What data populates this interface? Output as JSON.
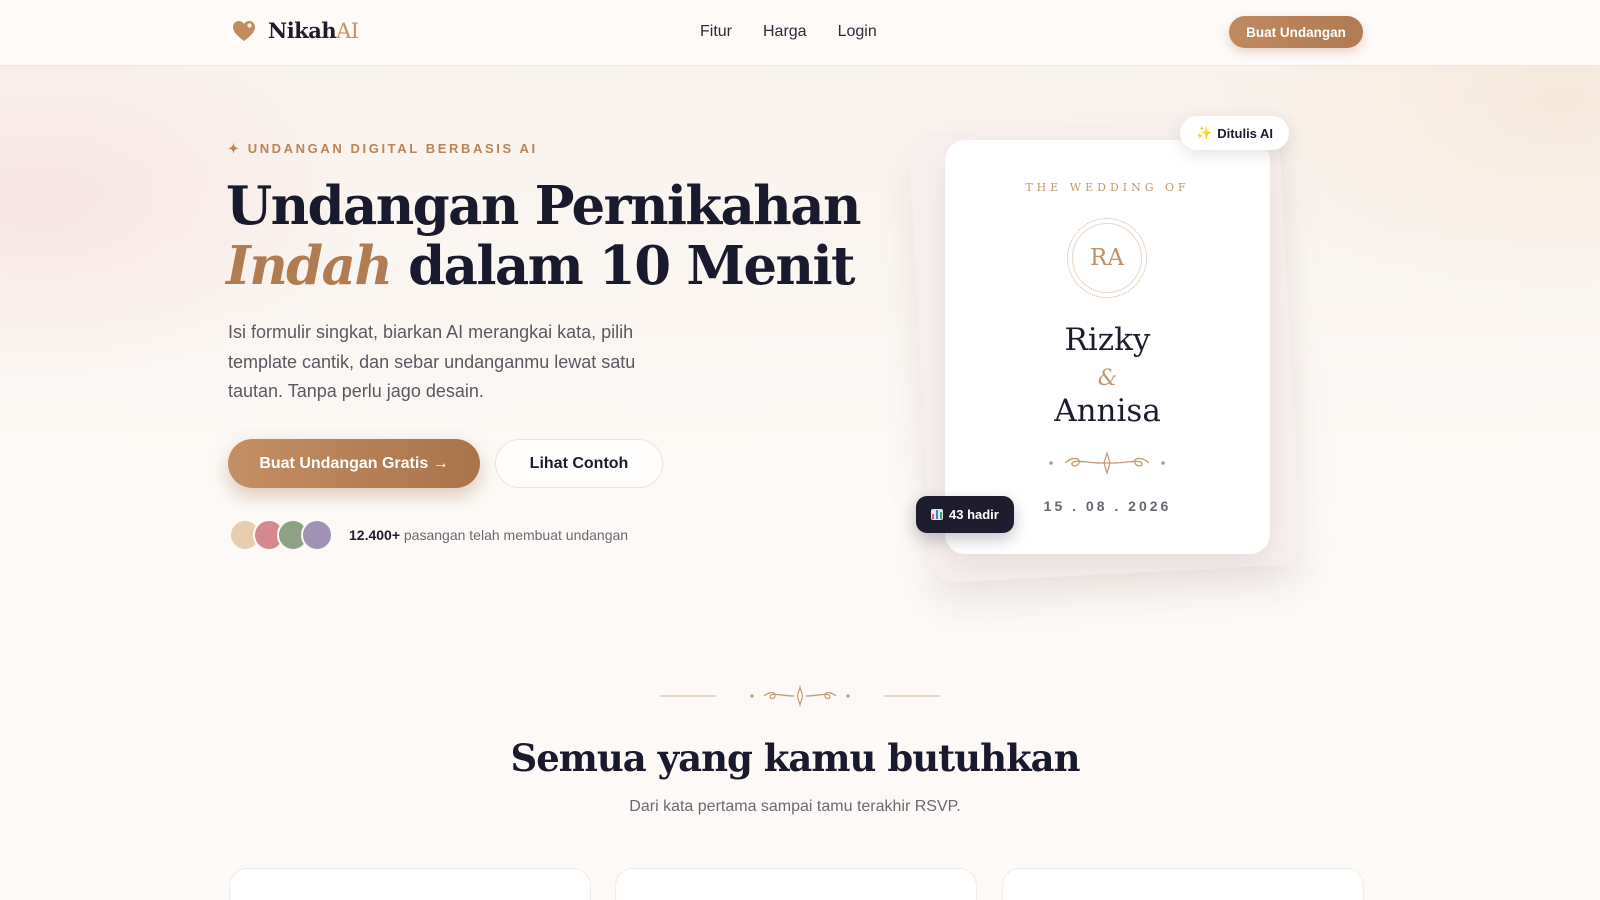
{
  "brand": {
    "name_main": "Nikah",
    "name_accent": "AI"
  },
  "nav": {
    "links": [
      "Fitur",
      "Harga",
      "Login"
    ],
    "cta_label": "Buat Undangan"
  },
  "hero": {
    "eyebrow": "✦ UNDANGAN DIGITAL BERBASIS AI",
    "title_line1": "Undangan Pernikahan",
    "title_accent": "Indah",
    "title_line2_rest": " dalam 10 Menit",
    "subtitle": "Isi formulir singkat, biarkan AI merangkai kata, pilih template cantik, dan sebar undanganmu lewat satu tautan. Tanpa perlu jago desain.",
    "primary_cta": "Buat Undangan Gratis →",
    "secondary_cta": "Lihat Contoh",
    "social_proof_count": "12.400+",
    "social_proof_text": " pasangan telah membuat undangan",
    "avatar_colors": [
      "#e8cdb0",
      "#d48a8c",
      "#8ea285",
      "#a293b6"
    ]
  },
  "invitation_card": {
    "kicker": "THE WEDDING OF",
    "monogram": "RA",
    "name_1": "Rizky",
    "ampersand": "&",
    "name_2": "Annisa",
    "date": "15 . 08 . 2026",
    "badge_ai": "Ditulis AI",
    "badge_count": "43 hadir"
  },
  "features_section": {
    "title": "Semua yang kamu butuhkan",
    "subtitle": "Dari kata pertama sampai tamu terakhir RSVP."
  },
  "colors": {
    "accent": "#b07a52",
    "dark": "#1d1d2f",
    "background": "#fcf9f6"
  },
  "icons": [
    "heart-logo-icon",
    "sparkles-icon",
    "bar-chart-icon",
    "ornament-divider-icon"
  ]
}
